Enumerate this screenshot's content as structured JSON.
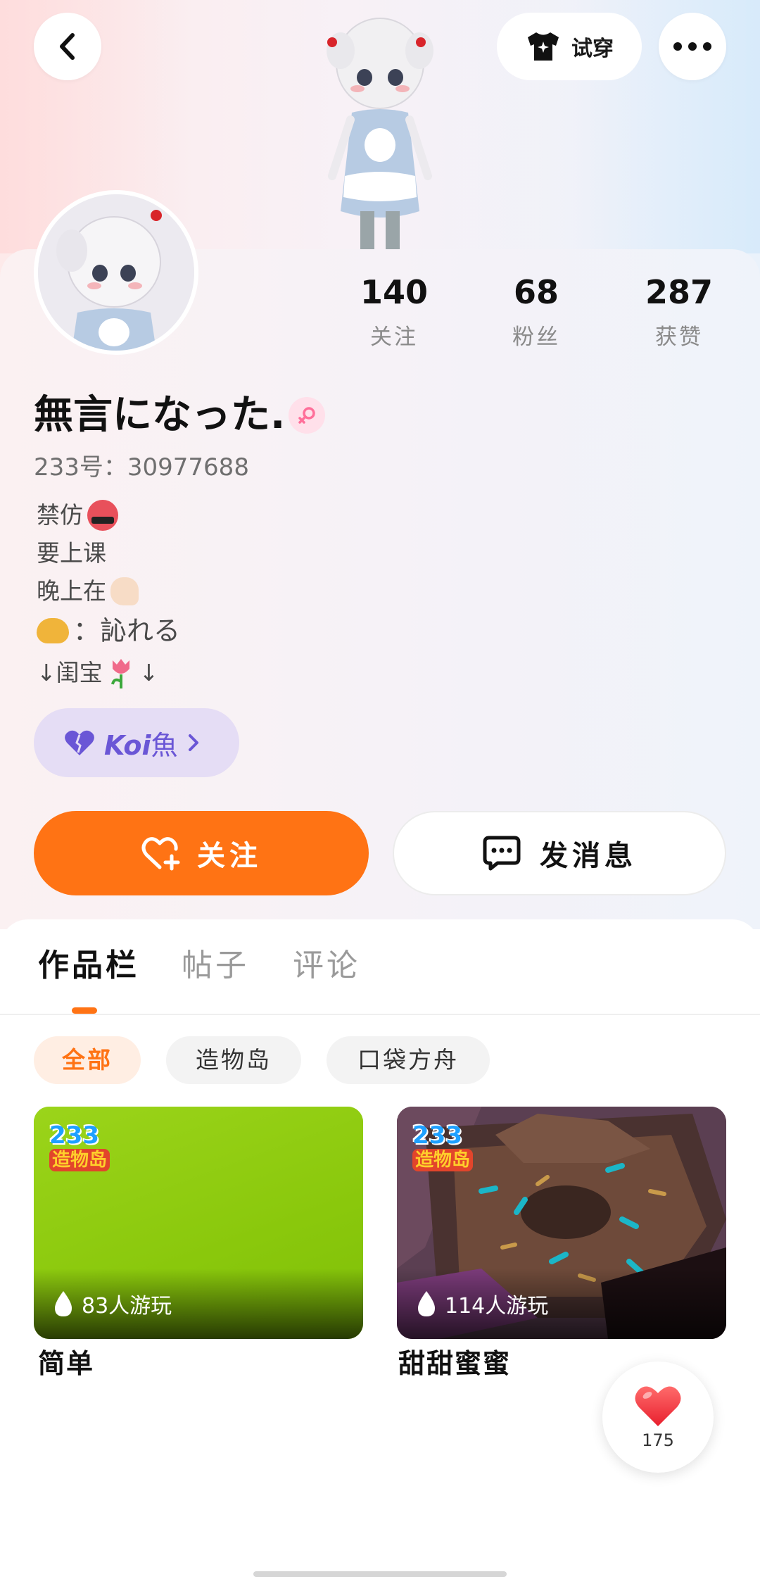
{
  "header": {
    "tryon_label": "试穿",
    "icons": {
      "back": "chevron-left-icon",
      "tryon": "tshirt-icon",
      "more": "more-dots-icon"
    }
  },
  "profile": {
    "stats": [
      {
        "value": "140",
        "label": "关注"
      },
      {
        "value": "68",
        "label": "粉丝"
      },
      {
        "value": "287",
        "label": "获赞"
      }
    ],
    "username": "無言になった.",
    "gender": "female",
    "account_id": "233号：30977688",
    "bio": {
      "line1": "禁仿",
      "line2": "要上课",
      "line3": "晚上在",
      "line4": "：訫れる",
      "line5_left": "↓闺宝",
      "line5_right": "↓"
    },
    "koi_chip": {
      "label_latin": "Koi",
      "label_cjk": "魚"
    }
  },
  "actions": {
    "follow_label": "关注",
    "message_label": "发消息"
  },
  "tabs": [
    "作品栏",
    "帖子",
    "评论"
  ],
  "filters": [
    "全部",
    "造物岛",
    "口袋方舟"
  ],
  "works": [
    {
      "logo_number": "233",
      "logo_text": "造物岛",
      "plays": "83人游玩",
      "title": "简单",
      "thumb_color": "#8fcc10"
    },
    {
      "logo_number": "233",
      "logo_text": "造物岛",
      "plays": "114人游玩",
      "title": "甜甜蜜蜜",
      "thumb_color": "#5a3f4a"
    }
  ],
  "like_fab": {
    "count": "175"
  },
  "colors": {
    "accent": "#ff7314",
    "koi_purple": "#6a56d6",
    "koi_bg": "#e5ddf5",
    "gender_pink": "#ff6f9a"
  }
}
